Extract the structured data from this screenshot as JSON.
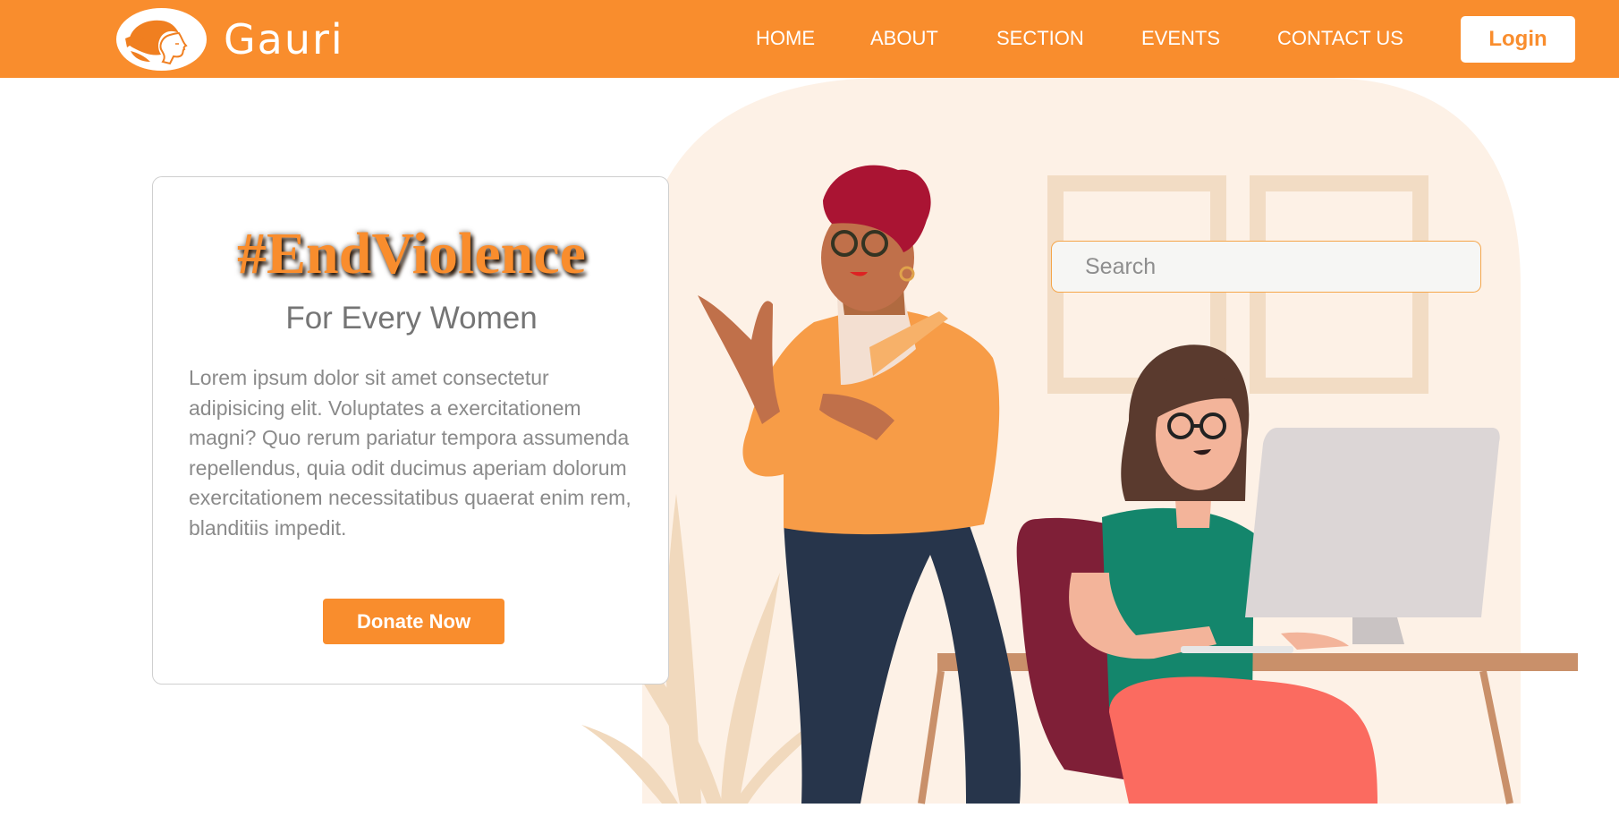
{
  "header": {
    "brand": "Gauri",
    "nav": [
      "HOME",
      "ABOUT",
      "SECTION",
      "EVENTS",
      "CONTACT US"
    ],
    "login_label": "Login"
  },
  "hero": {
    "hashtag": "#EndViolence",
    "subtitle": "For Every Women",
    "body": "Lorem ipsum dolor sit amet consectetur adipisicing elit. Voluptates a exercitationem magni? Quo rerum pariatur tempora assumenda repellendus, quia odit ducimus aperiam dolorum exercitationem necessitatibus quaerat enim rem, blanditiis impedit.",
    "donate_label": "Donate Now"
  },
  "search": {
    "placeholder": "Search",
    "value": ""
  },
  "colors": {
    "brand_orange": "#f98d2d",
    "text_gray": "#757575"
  },
  "icons": {
    "logo": "woman-profile-logo-icon"
  }
}
